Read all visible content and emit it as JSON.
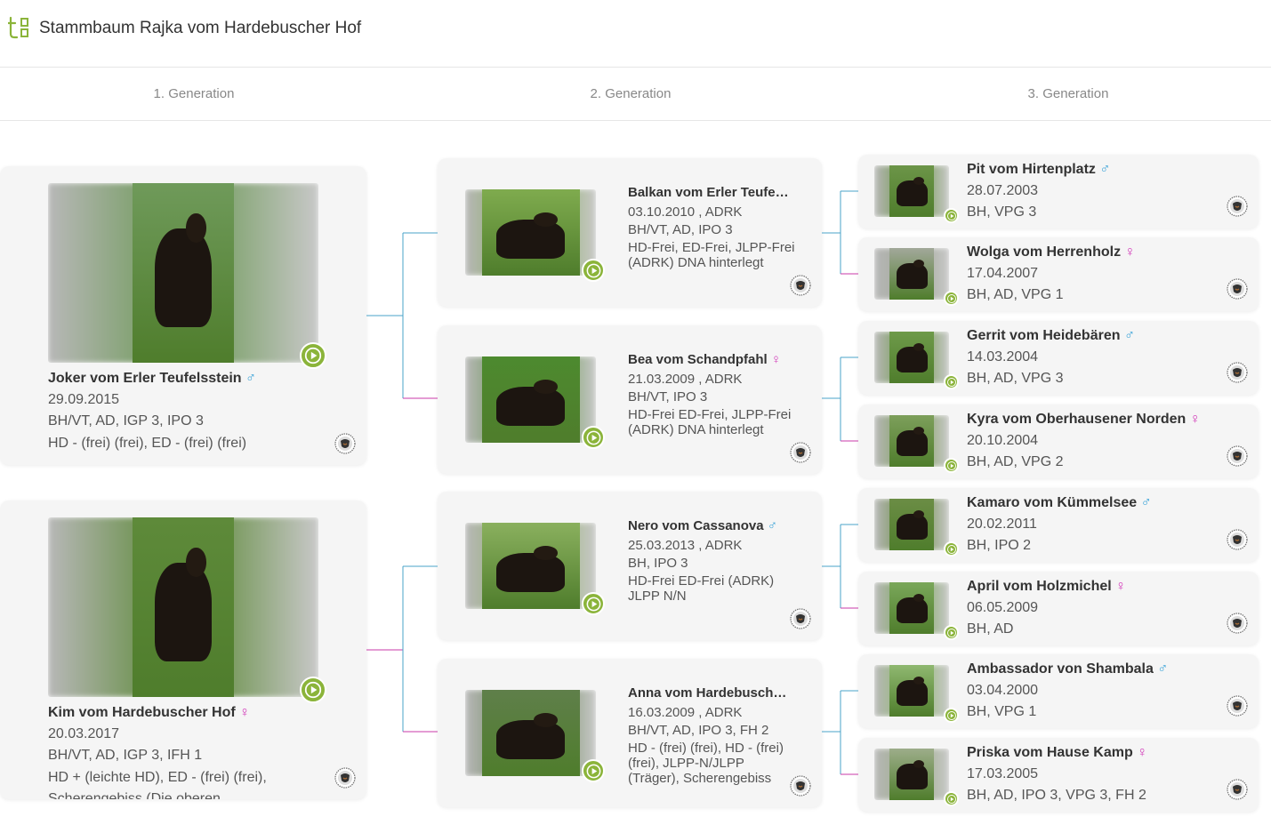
{
  "header": {
    "title": "Stammbaum Rajka vom Hardebuscher Hof"
  },
  "generations": [
    "1. Generation",
    "2. Generation",
    "3. Generation"
  ],
  "colors": {
    "accent": "#8bb43a",
    "male": "#3aa3d8",
    "female": "#d23ab9",
    "connector_male": "#4aa3c9",
    "connector_female": "#c83aa8"
  },
  "sex_symbols": {
    "male": "♂",
    "female": "♀"
  },
  "gen1": [
    {
      "name": "Joker vom Erler Teufelsstein",
      "sex": "male",
      "date": "29.09.2015",
      "titles": "BH/VT, AD, IGP 3, IPO 3",
      "health": "HD - (frei) (frei), ED - (frei) (frei)"
    },
    {
      "name": "Kim vom Hardebuscher Hof",
      "sex": "female",
      "date": "20.03.2017",
      "titles": "BH/VT, AD, IGP 3, IFH 1",
      "health": "HD + (leichte HD), ED - (frei) (frei), Scherengebiss (Die oberen"
    }
  ],
  "gen2": [
    {
      "name": "Balkan vom Erler Teufelsstein",
      "sex": "male",
      "date": "03.10.2010 , ADRK",
      "titles": "BH/VT, AD, IPO 3",
      "health": "HD-Frei, ED-Frei, JLPP-Frei (ADRK) DNA hinterlegt"
    },
    {
      "name": "Bea vom Schandpfahl",
      "sex": "female",
      "date": "21.03.2009 , ADRK",
      "titles": "BH/VT, IPO 3",
      "health": "HD-Frei ED-Frei, JLPP-Frei (ADRK) DNA hinterlegt"
    },
    {
      "name": "Nero vom Cassanova",
      "sex": "male",
      "date": "25.03.2013 , ADRK",
      "titles": "BH, IPO 3",
      "health": "HD-Frei ED-Frei (ADRK) JLPP N/N"
    },
    {
      "name": "Anna vom Hardebuscher Hof",
      "sex": "female",
      "date": "16.03.2009 , ADRK",
      "titles": "BH/VT, AD, IPO 3, FH 2",
      "health": "HD - (frei) (frei), HD - (frei) (frei), JLPP-N/JLPP (Träger), Scherengebiss"
    }
  ],
  "gen3": [
    {
      "name": "Pit vom Hirtenplatz",
      "sex": "male",
      "date": "28.07.2003",
      "titles": "BH, VPG 3"
    },
    {
      "name": "Wolga vom Herrenholz",
      "sex": "female",
      "date": "17.04.2007",
      "titles": "BH, AD, VPG 1"
    },
    {
      "name": "Gerrit vom Heidebären",
      "sex": "male",
      "date": "14.03.2004",
      "titles": "BH, AD, VPG 3"
    },
    {
      "name": "Kyra vom Oberhausener Norden",
      "sex": "female",
      "date": "20.10.2004",
      "titles": "BH, AD, VPG 2"
    },
    {
      "name": "Kamaro vom Kümmelsee",
      "sex": "male",
      "date": "20.02.2011",
      "titles": "BH, IPO 2"
    },
    {
      "name": "April vom Holzmichel",
      "sex": "female",
      "date": "06.05.2009",
      "titles": "BH, AD"
    },
    {
      "name": "Ambassador von Shambala",
      "sex": "male",
      "date": "03.04.2000",
      "titles": "BH, VPG 1"
    },
    {
      "name": "Priska vom Hause Kamp",
      "sex": "female",
      "date": "17.03.2005",
      "titles": "BH, AD, IPO 3, VPG 3, FH 2"
    }
  ]
}
